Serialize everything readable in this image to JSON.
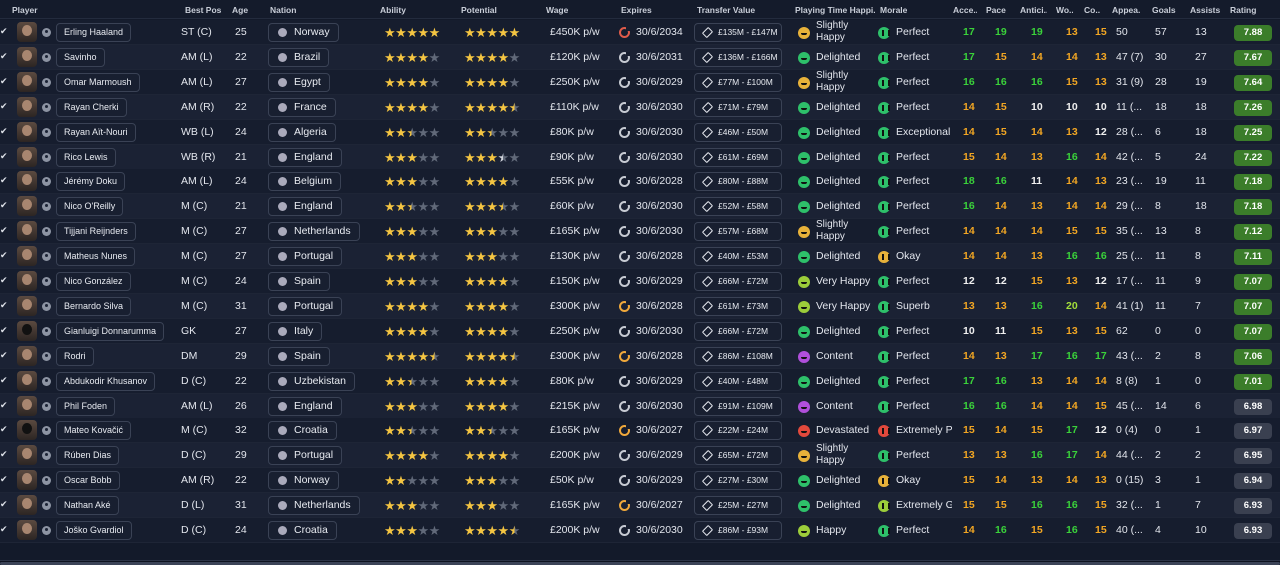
{
  "headers": {
    "player": "Player",
    "best_pos": "Best Pos",
    "age": "Age",
    "nation": "Nation",
    "ability": "Ability",
    "potential": "Potential",
    "wage": "Wage",
    "expires": "Expires",
    "transfer_value": "Transfer Value",
    "playing_time": "Playing Time Happi...",
    "morale": "Morale",
    "acc": "Acce...",
    "pace": "Pace",
    "antic": "Antici...",
    "wo": "Wo...",
    "co": "Co...",
    "appe": "Appea...",
    "goals": "Goals",
    "assists": "Assists",
    "rating": "Rating"
  },
  "colors": {
    "attr_green": "#3ad23a",
    "attr_yellow": "#f2a623",
    "attr_white": "#f0f0f0",
    "attr_lime": "#a3df3a",
    "rating_green": "#3b7d2a",
    "rating_grey": "#3a4050",
    "star_gold": "#f4c542"
  },
  "players": [
    {
      "name": "Erling Haaland",
      "pos": "ST (C)",
      "age": "25",
      "nation": "Norway",
      "ability": 5,
      "potential": 5,
      "wage": "£450K p/w",
      "expires": "30/6/2034",
      "expires_icon": "red",
      "value": "£135M - £147M",
      "pt": "Slightly Happy",
      "pt_face": "sl",
      "morale": "Perfect",
      "morale_icon": "pf",
      "attrs": [
        "17",
        "19",
        "19",
        "13",
        "15"
      ],
      "apps": "50",
      "goals": "57",
      "assists": "13",
      "rating": "7.88"
    },
    {
      "name": "Savinho",
      "pos": "AM (L)",
      "age": "22",
      "nation": "Brazil",
      "ability": 4,
      "potential": 4,
      "wage": "£120K p/w",
      "expires": "30/6/2031",
      "expires_icon": "white",
      "value": "£136M - £166M",
      "pt": "Delighted",
      "pt_face": "ok",
      "morale": "Perfect",
      "morale_icon": "pf",
      "attrs": [
        "17",
        "15",
        "14",
        "14",
        "13"
      ],
      "apps": "47 (7)",
      "goals": "30",
      "assists": "27",
      "rating": "7.67"
    },
    {
      "name": "Omar Marmoush",
      "pos": "AM (L)",
      "age": "27",
      "nation": "Egypt",
      "ability": 4,
      "potential": 4,
      "wage": "£250K p/w",
      "expires": "30/6/2029",
      "expires_icon": "white",
      "value": "£77M - £100M",
      "pt": "Slightly Happy",
      "pt_face": "sl",
      "morale": "Perfect",
      "morale_icon": "pf",
      "attrs": [
        "16",
        "16",
        "16",
        "15",
        "13"
      ],
      "apps": "31 (9)",
      "goals": "28",
      "assists": "19",
      "rating": "7.64"
    },
    {
      "name": "Rayan Cherki",
      "pos": "AM (R)",
      "age": "22",
      "nation": "France",
      "ability": 4,
      "potential": 4.5,
      "wage": "£110K p/w",
      "expires": "30/6/2030",
      "expires_icon": "white",
      "value": "£71M - £79M",
      "pt": "Delighted",
      "pt_face": "ok",
      "morale": "Perfect",
      "morale_icon": "pf",
      "attrs": [
        "14",
        "15",
        "10",
        "10",
        "10"
      ],
      "apps": "11 (...",
      "goals": "18",
      "assists": "18",
      "rating": "7.26"
    },
    {
      "name": "Rayan Aït-Nouri",
      "pos": "WB (L)",
      "age": "24",
      "nation": "Algeria",
      "ability": 2.5,
      "potential": 2.5,
      "wage": "£80K p/w",
      "expires": "30/6/2030",
      "expires_icon": "white",
      "value": "£46M - £50M",
      "pt": "Delighted",
      "pt_face": "ok",
      "morale": "Exceptional",
      "morale_icon": "ex",
      "attrs": [
        "14",
        "15",
        "14",
        "13",
        "12"
      ],
      "apps": "28 (...",
      "goals": "6",
      "assists": "18",
      "rating": "7.25"
    },
    {
      "name": "Rico Lewis",
      "pos": "WB (R)",
      "age": "21",
      "nation": "England",
      "ability": 3,
      "potential": 3.5,
      "pot_white": true,
      "wage": "£90K p/w",
      "expires": "30/6/2030",
      "expires_icon": "white",
      "value": "£61M - £69M",
      "pt": "Delighted",
      "pt_face": "ok",
      "morale": "Perfect",
      "morale_icon": "pf",
      "attrs": [
        "15",
        "14",
        "13",
        "16",
        "14"
      ],
      "apps": "42 (...",
      "goals": "5",
      "assists": "24",
      "rating": "7.22"
    },
    {
      "name": "Jérémy Doku",
      "pos": "AM (L)",
      "age": "24",
      "nation": "Belgium",
      "ability": 3,
      "potential": 4,
      "wage": "£55K p/w",
      "expires": "30/6/2028",
      "expires_icon": "white",
      "value": "£80M - £88M",
      "pt": "Delighted",
      "pt_face": "ok",
      "morale": "Perfect",
      "morale_icon": "pf",
      "attrs": [
        "18",
        "16",
        "11",
        "14",
        "13"
      ],
      "apps": "23 (...",
      "goals": "19",
      "assists": "11",
      "rating": "7.18"
    },
    {
      "name": "Nico O'Reilly",
      "pos": "M (C)",
      "age": "21",
      "nation": "England",
      "ability": 2.5,
      "potential": 3.5,
      "wage": "£60K p/w",
      "expires": "30/6/2030",
      "expires_icon": "white",
      "value": "£52M - £58M",
      "pt": "Delighted",
      "pt_face": "ok",
      "morale": "Perfect",
      "morale_icon": "pf",
      "attrs": [
        "16",
        "14",
        "13",
        "14",
        "14"
      ],
      "apps": "29 (...",
      "goals": "8",
      "assists": "18",
      "rating": "7.18"
    },
    {
      "name": "Tijjani Reijnders",
      "pos": "M (C)",
      "age": "27",
      "nation": "Netherlands",
      "ability": 3,
      "potential": 3,
      "wage": "£165K p/w",
      "expires": "30/6/2030",
      "expires_icon": "white",
      "value": "£57M - £68M",
      "pt": "Slightly Happy",
      "pt_face": "sl",
      "morale": "Perfect",
      "morale_icon": "pf",
      "attrs": [
        "14",
        "14",
        "14",
        "15",
        "15"
      ],
      "apps": "35 (...",
      "goals": "13",
      "assists": "8",
      "rating": "7.12"
    },
    {
      "name": "Matheus Nunes",
      "pos": "M (C)",
      "age": "27",
      "nation": "Portugal",
      "ability": 3,
      "potential": 3,
      "wage": "£130K p/w",
      "expires": "30/6/2028",
      "expires_icon": "white",
      "value": "£40M - £53M",
      "pt": "Delighted",
      "pt_face": "ok",
      "morale": "Okay",
      "morale_icon": "ok",
      "attrs": [
        "14",
        "14",
        "13",
        "16",
        "16"
      ],
      "apps": "25 (...",
      "goals": "11",
      "assists": "8",
      "rating": "7.11"
    },
    {
      "name": "Nico González",
      "pos": "M (C)",
      "age": "24",
      "nation": "Spain",
      "ability": 3,
      "potential": 4,
      "wage": "£150K p/w",
      "expires": "30/6/2029",
      "expires_icon": "white",
      "value": "£66M - £72M",
      "pt": "Very Happy",
      "pt_face": "vh",
      "morale": "Perfect",
      "morale_icon": "pf",
      "attrs": [
        "12",
        "12",
        "15",
        "13",
        "12"
      ],
      "apps": "17 (...",
      "goals": "11",
      "assists": "9",
      "rating": "7.07"
    },
    {
      "name": "Bernardo Silva",
      "pos": "M (C)",
      "age": "31",
      "nation": "Portugal",
      "ability": 4,
      "potential": 4,
      "wage": "£300K p/w",
      "expires": "30/6/2028",
      "expires_icon": "yel",
      "value": "£61M - £73M",
      "pt": "Very Happy",
      "pt_face": "vh",
      "morale": "Superb",
      "morale_icon": "sb",
      "attrs": [
        "13",
        "13",
        "16",
        "20",
        "14"
      ],
      "apps": "41 (1)",
      "goals": "11",
      "assists": "7",
      "rating": "7.07"
    },
    {
      "name": "Gianluigi Donnarumma",
      "pos": "GK",
      "age": "27",
      "nation": "Italy",
      "ability": 4,
      "potential": 4,
      "wage": "£250K p/w",
      "expires": "30/6/2030",
      "expires_icon": "white",
      "value": "£66M - £72M",
      "pt": "Delighted",
      "pt_face": "ok",
      "morale": "Perfect",
      "morale_icon": "pf",
      "attrs": [
        "10",
        "11",
        "15",
        "13",
        "15"
      ],
      "apps": "62",
      "goals": "0",
      "assists": "0",
      "rating": "7.07",
      "dark": true
    },
    {
      "name": "Rodri",
      "pos": "DM",
      "age": "29",
      "nation": "Spain",
      "ability": 4.5,
      "potential": 4.5,
      "wage": "£300K p/w",
      "expires": "30/6/2028",
      "expires_icon": "yel",
      "value": "£86M - £108M",
      "pt": "Content",
      "pt_face": "ct",
      "morale": "Perfect",
      "morale_icon": "pf",
      "attrs": [
        "14",
        "13",
        "17",
        "16",
        "17"
      ],
      "apps": "43 (...",
      "goals": "2",
      "assists": "8",
      "rating": "7.06"
    },
    {
      "name": "Abdukodir Khusanov",
      "pos": "D (C)",
      "age": "22",
      "nation": "Uzbekistan",
      "ability": 2.5,
      "potential": 4,
      "wage": "£80K p/w",
      "expires": "30/6/2029",
      "expires_icon": "white",
      "value": "£40M - £48M",
      "pt": "Delighted",
      "pt_face": "ok",
      "morale": "Perfect",
      "morale_icon": "pf",
      "attrs": [
        "17",
        "16",
        "13",
        "14",
        "14"
      ],
      "apps": "8 (8)",
      "goals": "1",
      "assists": "0",
      "rating": "7.01"
    },
    {
      "name": "Phil Foden",
      "pos": "AM (L)",
      "age": "26",
      "nation": "England",
      "ability": 3,
      "potential": 4,
      "wage": "£215K p/w",
      "expires": "30/6/2030",
      "expires_icon": "white",
      "value": "£91M - £109M",
      "pt": "Content",
      "pt_face": "ct",
      "morale": "Perfect",
      "morale_icon": "pf",
      "attrs": [
        "16",
        "16",
        "14",
        "14",
        "15"
      ],
      "apps": "45 (...",
      "goals": "14",
      "assists": "6",
      "rating": "6.98"
    },
    {
      "name": "Mateo Kovačić",
      "pos": "M (C)",
      "age": "32",
      "nation": "Croatia",
      "ability": 2.5,
      "potential": 2.5,
      "wage": "£165K p/w",
      "expires": "30/6/2027",
      "expires_icon": "yel",
      "value": "£22M - £24M",
      "pt": "Devastated",
      "pt_face": "dv",
      "morale": "Extremely P",
      "morale_icon": "ep",
      "attrs": [
        "15",
        "14",
        "15",
        "17",
        "12"
      ],
      "apps": "0 (4)",
      "goals": "0",
      "assists": "1",
      "rating": "6.97",
      "dark": true
    },
    {
      "name": "Rúben Dias",
      "pos": "D (C)",
      "age": "29",
      "nation": "Portugal",
      "ability": 4,
      "potential": 4,
      "wage": "£200K p/w",
      "expires": "30/6/2029",
      "expires_icon": "white",
      "value": "£65M - £72M",
      "pt": "Slightly Happy",
      "pt_face": "sl",
      "morale": "Perfect",
      "morale_icon": "pf",
      "attrs": [
        "13",
        "13",
        "16",
        "17",
        "14"
      ],
      "apps": "44 (...",
      "goals": "2",
      "assists": "2",
      "rating": "6.95"
    },
    {
      "name": "Oscar Bobb",
      "pos": "AM (R)",
      "age": "22",
      "nation": "Norway",
      "ability": 2,
      "potential": 3,
      "wage": "£50K p/w",
      "expires": "30/6/2029",
      "expires_icon": "white",
      "value": "£27M - £30M",
      "pt": "Delighted",
      "pt_face": "ok",
      "morale": "Okay",
      "morale_icon": "ok",
      "attrs": [
        "15",
        "14",
        "13",
        "14",
        "13"
      ],
      "apps": "0 (15)",
      "goals": "3",
      "assists": "1",
      "rating": "6.94"
    },
    {
      "name": "Nathan Aké",
      "pos": "D (L)",
      "age": "31",
      "nation": "Netherlands",
      "ability": 3,
      "potential": 3,
      "wage": "£165K p/w",
      "expires": "30/6/2027",
      "expires_icon": "yel",
      "value": "£25M - £27M",
      "pt": "Delighted",
      "pt_face": "ok",
      "morale": "Extremely G",
      "morale_icon": "eg",
      "attrs": [
        "15",
        "15",
        "16",
        "16",
        "15"
      ],
      "apps": "32 (...",
      "goals": "1",
      "assists": "7",
      "rating": "6.93"
    },
    {
      "name": "Joško Gvardiol",
      "pos": "D (C)",
      "age": "24",
      "nation": "Croatia",
      "ability": 3,
      "potential": 4.5,
      "wage": "£200K p/w",
      "expires": "30/6/2030",
      "expires_icon": "white",
      "value": "£86M - £93M",
      "pt": "Happy",
      "pt_face": "vh",
      "morale": "Perfect",
      "morale_icon": "pf",
      "attrs": [
        "14",
        "16",
        "15",
        "16",
        "15"
      ],
      "apps": "40 (...",
      "goals": "4",
      "assists": "10",
      "rating": "6.93"
    }
  ]
}
